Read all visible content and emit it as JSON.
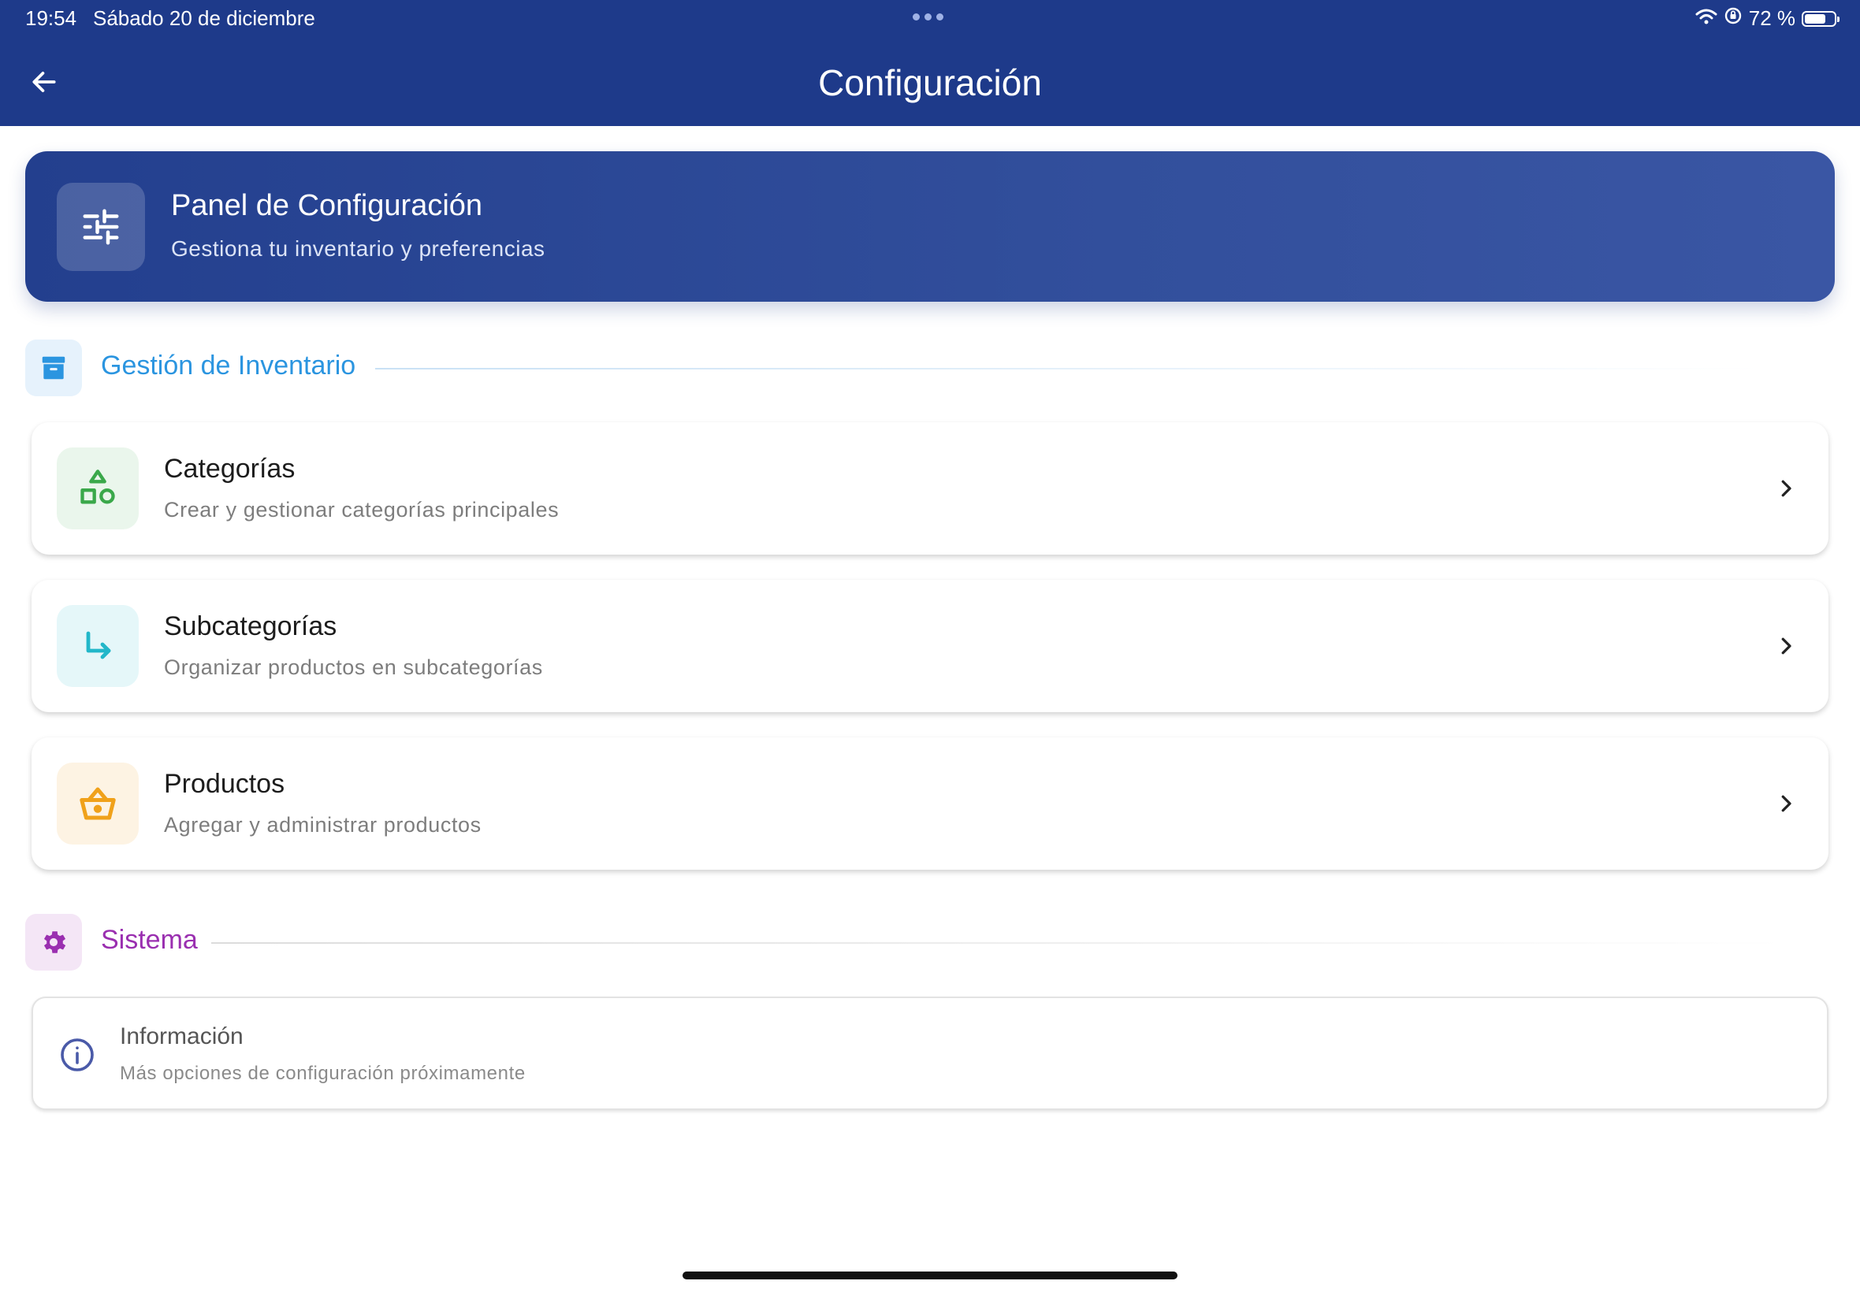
{
  "status_bar": {
    "time": "19:54",
    "date": "Sábado 20 de diciembre",
    "battery": "72 %",
    "battery_level": 0.72
  },
  "header": {
    "title": "Configuración",
    "back_icon": "arrow-left-icon"
  },
  "hero": {
    "title": "Panel de Configuración",
    "subtitle": "Gestiona tu inventario y preferencias",
    "icon": "sliders-icon"
  },
  "sections": {
    "inventory": {
      "title": "Gestión de Inventario",
      "icon": "archive-box-icon",
      "color": "#2b95e0",
      "items": [
        {
          "title": "Categorías",
          "subtitle": "Crear y gestionar categorías principales",
          "icon": "shapes-icon",
          "color": "#3aa84a"
        },
        {
          "title": "Subcategorías",
          "subtitle": "Organizar productos en subcategorías",
          "icon": "subdirectory-arrow-icon",
          "color": "#22b7c9"
        },
        {
          "title": "Productos",
          "subtitle": "Agregar y administrar productos",
          "icon": "basket-icon",
          "color": "#f0a11a"
        }
      ]
    },
    "system": {
      "title": "Sistema",
      "icon": "gear-icon",
      "color": "#9a2fb0",
      "info": {
        "title": "Información",
        "subtitle": "Más opciones de configuración próximamente",
        "icon": "info-circle-icon"
      }
    }
  },
  "colors": {
    "header_bg": "#1e3a8a",
    "hero_bg": "#2c4796"
  }
}
